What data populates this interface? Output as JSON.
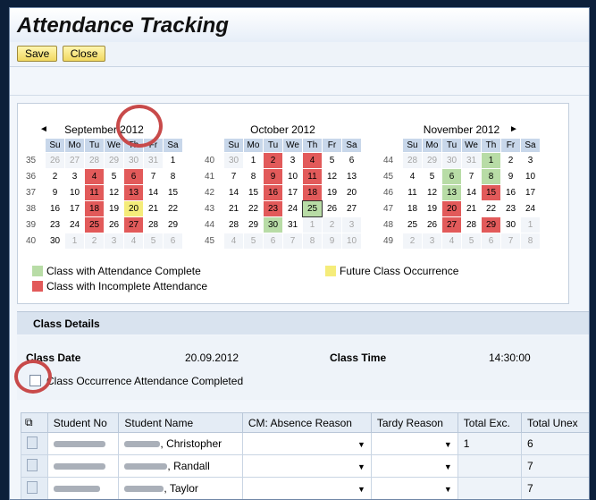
{
  "title": "Attendance Tracking",
  "toolbar": {
    "save": "Save",
    "close": "Close"
  },
  "calendar": {
    "nav_prev": "◄",
    "nav_next": "►",
    "months": [
      {
        "name": "September 2012",
        "rows": [
          [
            "35",
            "26",
            "27",
            "28",
            "29",
            "30",
            "31",
            "1"
          ],
          [
            "36",
            "2",
            "3",
            "4",
            "5",
            "6",
            "7",
            "8"
          ],
          [
            "37",
            "9",
            "10",
            "11",
            "12",
            "13",
            "14",
            "15"
          ],
          [
            "38",
            "16",
            "17",
            "18",
            "19",
            "20",
            "21",
            "22"
          ],
          [
            "39",
            "23",
            "24",
            "25",
            "26",
            "27",
            "28",
            "29"
          ],
          [
            "40",
            "30",
            "1",
            "2",
            "3",
            "4",
            "5",
            "6"
          ]
        ]
      },
      {
        "name": "October 2012",
        "rows": [
          [
            "40",
            "30",
            "1",
            "2",
            "3",
            "4",
            "5",
            "6"
          ],
          [
            "41",
            "7",
            "8",
            "9",
            "10",
            "11",
            "12",
            "13"
          ],
          [
            "42",
            "14",
            "15",
            "16",
            "17",
            "18",
            "19",
            "20"
          ],
          [
            "43",
            "21",
            "22",
            "23",
            "24",
            "25",
            "26",
            "27"
          ],
          [
            "44",
            "28",
            "29",
            "30",
            "31",
            "1",
            "2",
            "3"
          ],
          [
            "45",
            "4",
            "5",
            "6",
            "7",
            "8",
            "9",
            "10"
          ]
        ]
      },
      {
        "name": "November 2012",
        "rows": [
          [
            "44",
            "28",
            "29",
            "30",
            "31",
            "1",
            "2",
            "3"
          ],
          [
            "45",
            "4",
            "5",
            "6",
            "7",
            "8",
            "9",
            "10"
          ],
          [
            "46",
            "11",
            "12",
            "13",
            "14",
            "15",
            "16",
            "17"
          ],
          [
            "47",
            "18",
            "19",
            "20",
            "21",
            "22",
            "23",
            "24"
          ],
          [
            "48",
            "25",
            "26",
            "27",
            "28",
            "29",
            "30",
            "1"
          ],
          [
            "49",
            "2",
            "3",
            "4",
            "5",
            "6",
            "7",
            "8"
          ]
        ]
      }
    ],
    "weekdays": [
      "Su",
      "Mo",
      "Tu",
      "We",
      "Th",
      "Fr",
      "Sa"
    ],
    "legend": {
      "complete": "Class with Attendance Complete",
      "incomplete": "Class with Incomplete Attendance",
      "future": "Future Class Occurrence"
    },
    "colors": {
      "complete": "#b8dca6",
      "incomplete": "#e25a5a",
      "future": "#f5ec7a"
    }
  },
  "class_details": {
    "header": "Class Details",
    "date_label": "Class Date",
    "date_value": "20.09.2012",
    "time_label": "Class Time",
    "time_value": "14:30:00",
    "checkbox_label": "Class Occurrence Attendance Completed"
  },
  "table": {
    "columns": [
      "Student No",
      "Student Name",
      "CM: Absence Reason",
      "Tardy Reason",
      "Total Exc.",
      "Total Unex"
    ],
    "rows": [
      {
        "name": ", Christopher",
        "total_exc": "1",
        "total_unex": "6"
      },
      {
        "name": ", Randall",
        "total_exc": "",
        "total_unex": "7"
      },
      {
        "name": ", Taylor",
        "total_exc": "",
        "total_unex": "7"
      }
    ]
  }
}
